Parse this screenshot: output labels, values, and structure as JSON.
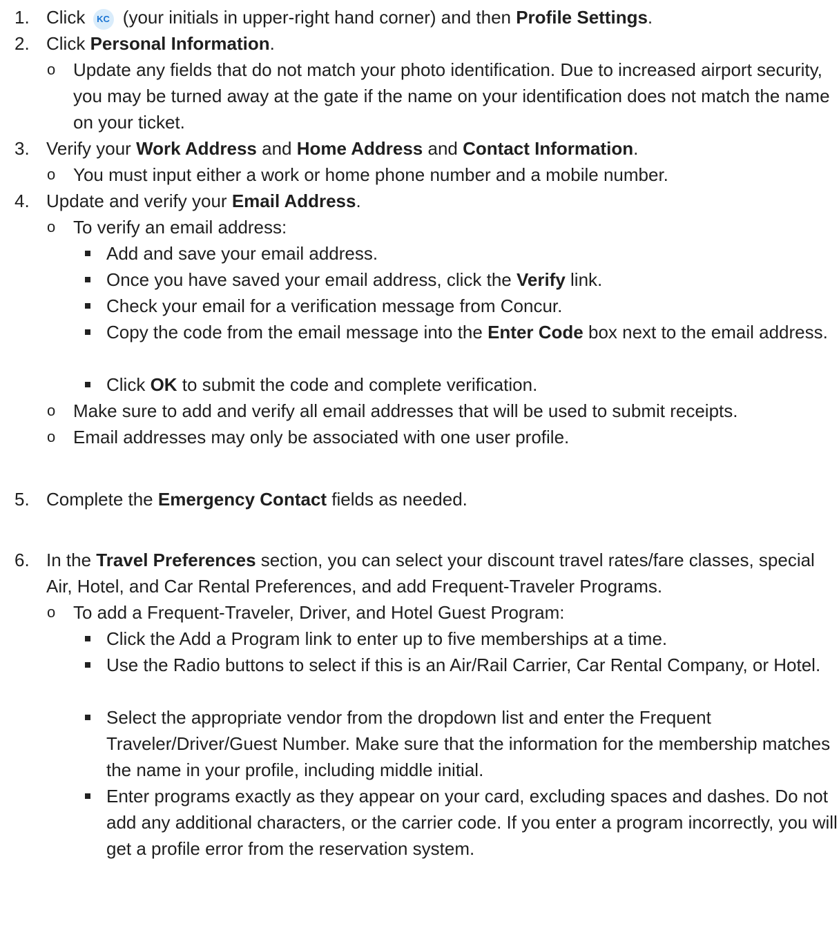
{
  "steps": {
    "s1": {
      "num": "1.",
      "a": "Click ",
      "badge": "KC",
      "b": " (your initials in upper-right hand corner) and then ",
      "bold1": "Profile Settings",
      "c": "."
    },
    "s2": {
      "num": "2.",
      "a": "Click ",
      "bold1": "Personal Information",
      "c": ".",
      "sub1": "Update any fields that do not match your photo identification. Due to increased airport security, you may be turned away at the gate if the name on your identification does not match the name on your ticket."
    },
    "s3": {
      "num": "3.",
      "a": "Verify your ",
      "bold1": "Work Address",
      "b": " and ",
      "bold2": "Home Address",
      "c": " and ",
      "bold3": "Contact Information",
      "d": ".",
      "sub1": "You must input either a work or home phone number and a mobile number."
    },
    "s4": {
      "num": "4.",
      "a": "Update and verify your ",
      "bold1": "Email Address",
      "c": ".",
      "sub1": "To verify an email address:",
      "b1": "Add and save your email address.",
      "b2a": "Once you have saved your email address, click the ",
      "b2bold": "Verify",
      "b2b": " link.",
      "b3": "Check your email for a verification message from Concur.",
      "b4a": "Copy the code from the email message into the ",
      "b4bold": "Enter Code",
      "b4b": " box next to the email address.",
      "b5a": "Click ",
      "b5bold": "OK",
      "b5b": " to submit the code and complete verification.",
      "sub2": "Make sure to add and verify all email addresses that will be used to submit receipts.",
      "sub3": "Email addresses may only be associated with one user profile."
    },
    "s5": {
      "num": "5.",
      "a": "Complete the ",
      "bold1": "Emergency Contact",
      "c": " fields as needed."
    },
    "s6": {
      "num": "6.",
      "a": "In the ",
      "bold1": "Travel Preferences",
      "c": " section, you can select your discount travel rates/fare classes, special Air, Hotel, and Car Rental Preferences, and add Frequent-Traveler Programs.",
      "sub1": "To add a Frequent-Traveler, Driver, and Hotel Guest Program:",
      "b1": "Click the Add a Program link to enter up to five memberships at a time.",
      "b2": "Use the Radio buttons to select if this is an Air/Rail Carrier, Car Rental Company, or Hotel.",
      "b3": "Select the appropriate vendor from the dropdown list and enter the Frequent Traveler/Driver/Guest Number. Make sure that the information for the membership matches the name in your profile, including middle initial.",
      "b4": "Enter programs exactly as they appear on your card, excluding spaces and dashes. Do not add any additional characters, or the carrier code. If you enter a program incorrectly, you will get a profile error from the reservation system."
    }
  },
  "bullets": {
    "level2": "o",
    "level3": "square"
  }
}
